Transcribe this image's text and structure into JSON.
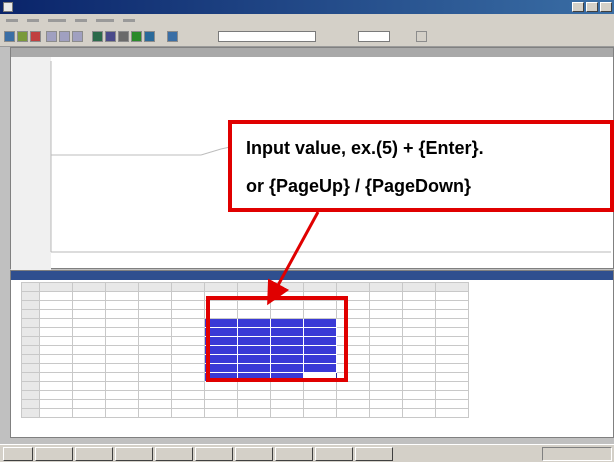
{
  "callout": {
    "line1": "Input value, ex.(5) + {Enter}.",
    "line2": "or {PageUp} / {PageDown}"
  },
  "colors": {
    "callout_border": "#e00000",
    "selected_cell": "#3a3ad6",
    "title_bar": "#0a246a"
  },
  "icons": [
    "app-icon",
    "save-icon",
    "open-icon",
    "print-icon",
    "graph-icon",
    "table-icon"
  ]
}
